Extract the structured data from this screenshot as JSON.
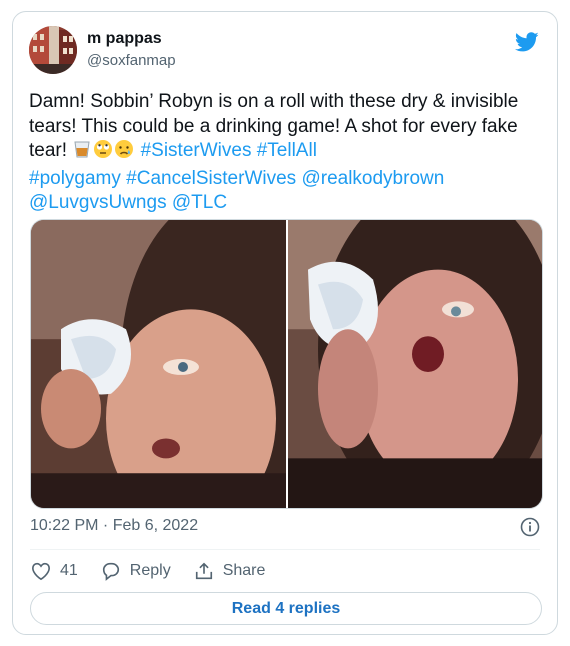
{
  "author": {
    "name": "m pappas",
    "handle": "@soxfanmap"
  },
  "tweet": {
    "segments": [
      {
        "t": "Damn! Sobbin’ Robyn is on a roll with these dry & invisible tears! This could be a drinking game! A shot for every fake tear! ",
        "type": "text"
      },
      {
        "t": "#SisterWives",
        "type": "link"
      },
      {
        "t": " ",
        "type": "text"
      },
      {
        "t": "#TellAll",
        "type": "link"
      },
      {
        "t": " ",
        "type": "text"
      },
      {
        "t": "#polygamy",
        "type": "link"
      },
      {
        "t": " ",
        "type": "text"
      },
      {
        "t": "#CancelSisterWives",
        "type": "link"
      },
      {
        "t": " ",
        "type": "text"
      },
      {
        "t": "@realkodybrown",
        "type": "link"
      },
      {
        "t": " ",
        "type": "text"
      },
      {
        "t": "@LuvgvsUwngs",
        "type": "link"
      },
      {
        "t": " ",
        "type": "text"
      },
      {
        "t": "@TLC",
        "type": "link"
      }
    ],
    "emojis": [
      "tumbler-glass",
      "rolling-eyes",
      "crying-face"
    ]
  },
  "timestamp": "10:22 PM · Feb 6, 2022",
  "actions": {
    "likes": "41",
    "reply_label": "Reply",
    "share_label": "Share"
  },
  "read_replies_label": "Read 4 replies",
  "colors": {
    "link": "#1d9bf0",
    "muted": "#536471",
    "text": "#0f1419"
  }
}
